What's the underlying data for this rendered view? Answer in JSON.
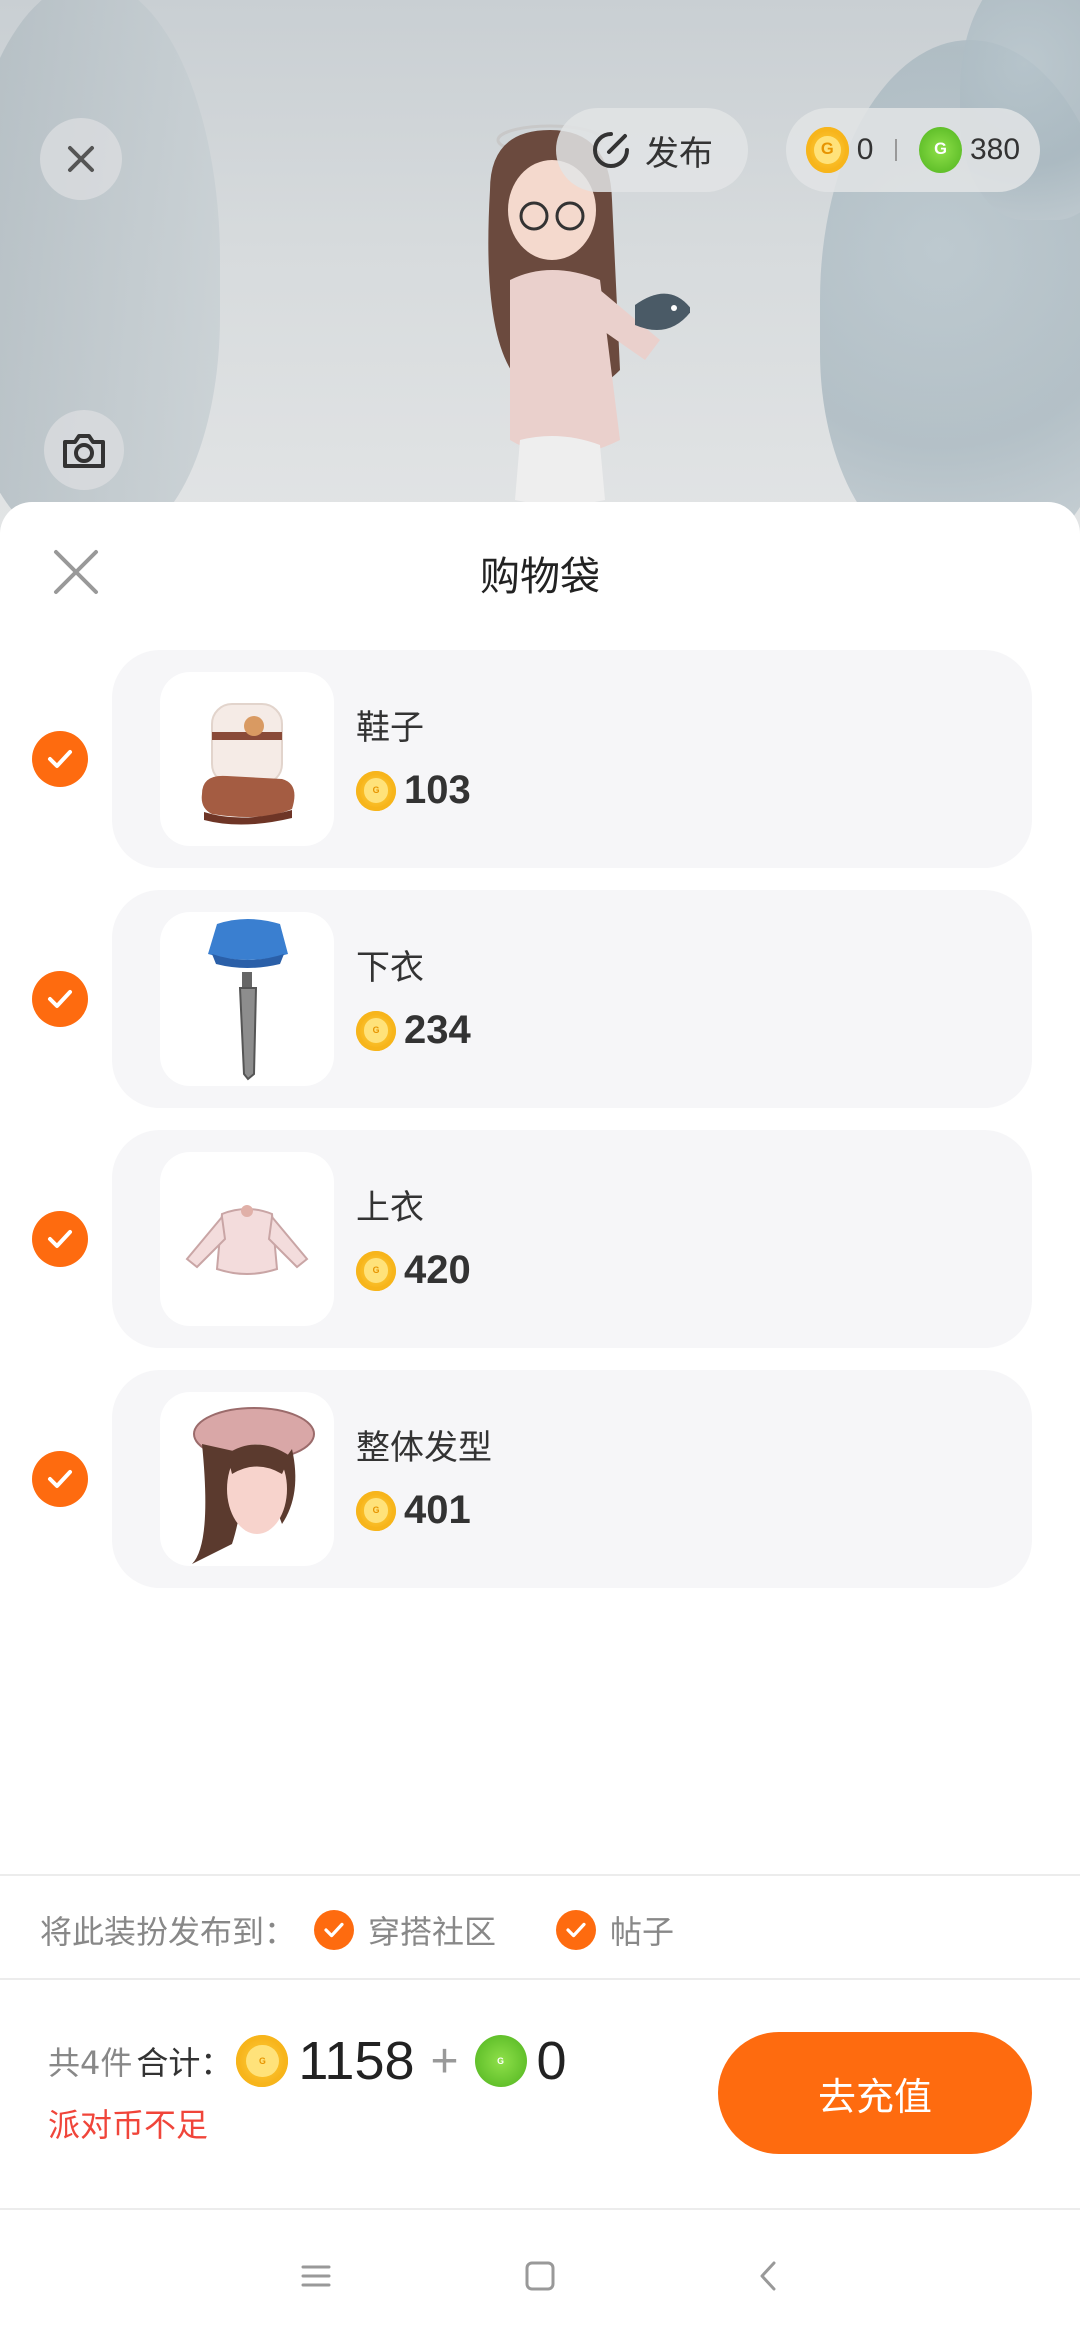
{
  "top": {
    "publish_label": "发布",
    "wallet": {
      "gold_coins": "0",
      "green_coins": "380"
    }
  },
  "sheet": {
    "title": "购物袋",
    "items": [
      {
        "name": "鞋子",
        "price": "103",
        "checked": true
      },
      {
        "name": "下衣",
        "price": "234",
        "checked": true
      },
      {
        "name": "上衣",
        "price": "420",
        "checked": true
      },
      {
        "name": "整体发型",
        "price": "401",
        "checked": true
      }
    ]
  },
  "publish_to": {
    "label": "将此装扮发布到：",
    "options": [
      {
        "label": "穿搭社区",
        "checked": true
      },
      {
        "label": "帖子",
        "checked": true
      }
    ]
  },
  "summary": {
    "count_text": "共4件",
    "total_label": "合计：",
    "gold_total": "1158",
    "plus": "+",
    "green_total": "0",
    "warning": "派对币不足",
    "recharge_label": "去充值"
  },
  "colors": {
    "accent": "#fe6b0f",
    "warning": "#f0453a",
    "card_bg": "#f6f6f8"
  },
  "icons": [
    "close-icon",
    "publish-icon",
    "gold-coin-icon",
    "green-coin-icon",
    "camera-icon",
    "check-icon",
    "menu-icon",
    "home-icon",
    "back-icon"
  ]
}
